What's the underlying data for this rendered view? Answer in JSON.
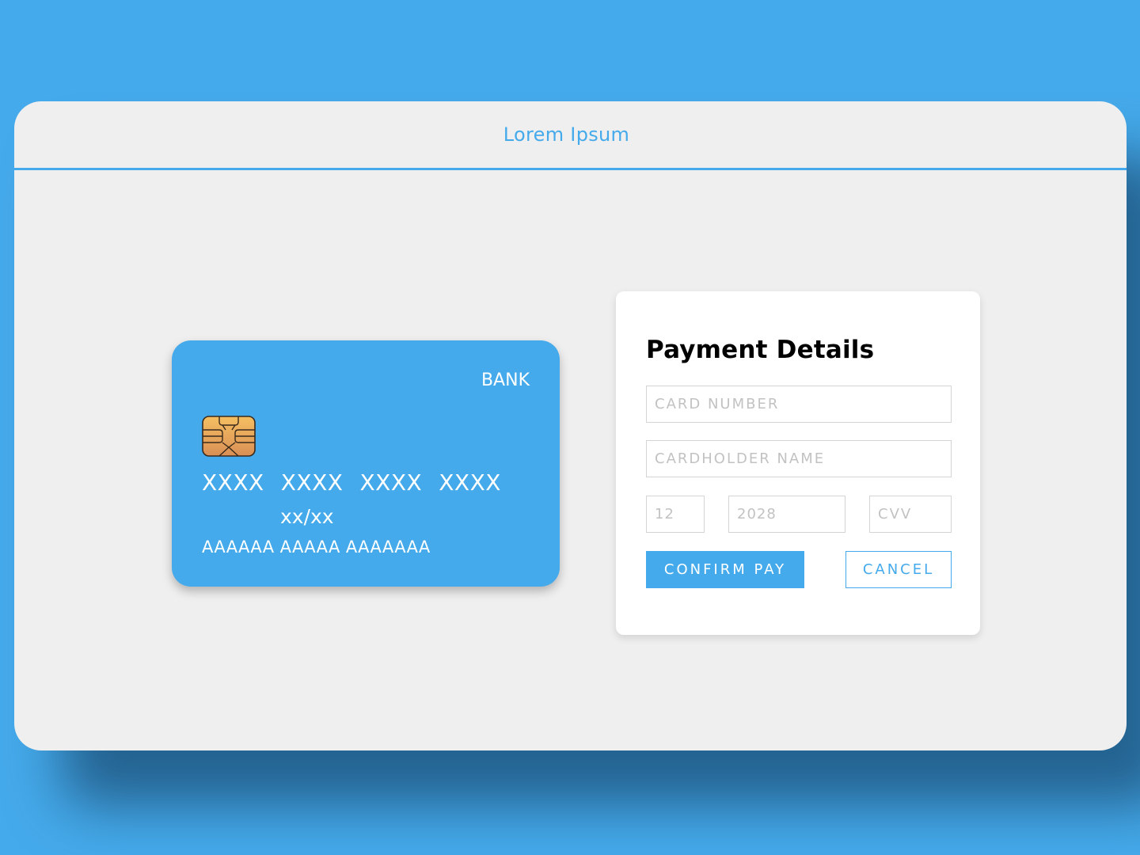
{
  "window": {
    "title": "Lorem Ipsum"
  },
  "card": {
    "bank": "BANK",
    "number_groups": [
      "XXXX",
      "XXXX",
      "XXXX",
      "XXXX"
    ],
    "expiry": "xx/xx",
    "holder": "AAAAAA AAAAA AAAAAAA",
    "chip_icon": "chip-icon"
  },
  "payment": {
    "title": "Payment Details",
    "card_number_placeholder": "CARD NUMBER",
    "cardholder_placeholder": "CARDHOLDER NAME",
    "month_placeholder": "12",
    "year_placeholder": "2028",
    "cvv_placeholder": "CVV",
    "confirm_label": "CONFIRM PAY",
    "cancel_label": "CANCEL"
  },
  "colors": {
    "accent": "#45aaeb",
    "panel": "#ffffff",
    "window": "#efefef"
  }
}
